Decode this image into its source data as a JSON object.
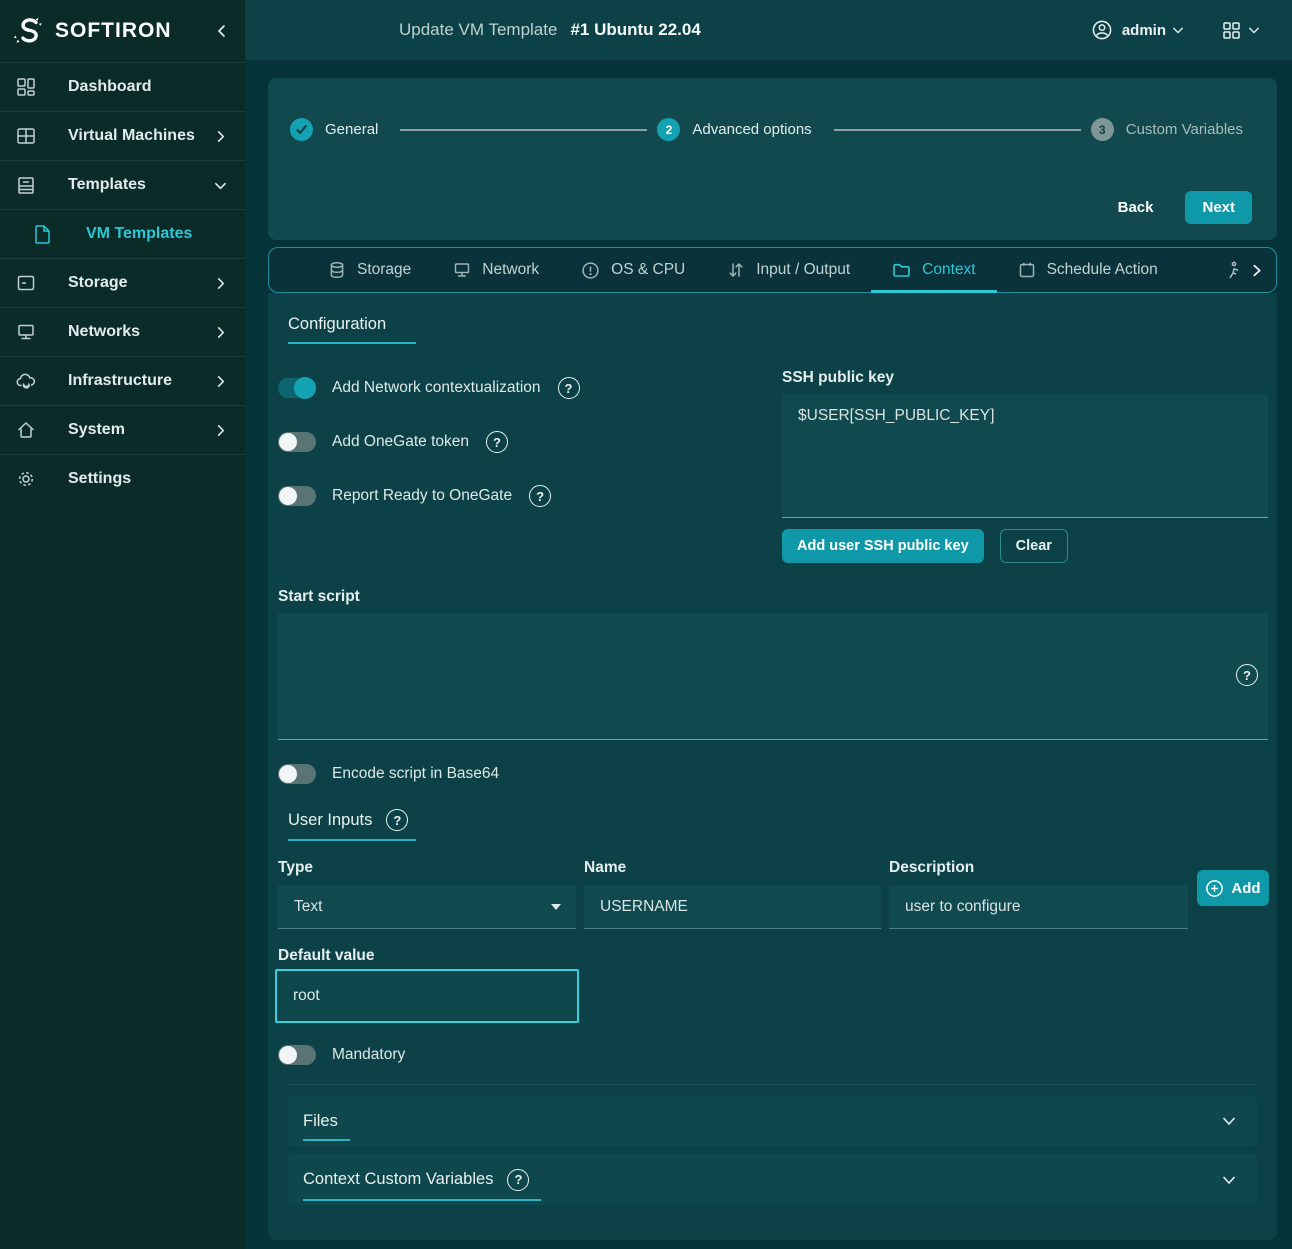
{
  "brand": {
    "name": "SOFTIRON"
  },
  "sidebar": {
    "items": [
      {
        "label": "Dashboard"
      },
      {
        "label": "Virtual Machines"
      },
      {
        "label": "Templates"
      },
      {
        "label": "VM Templates"
      },
      {
        "label": "Storage"
      },
      {
        "label": "Networks"
      },
      {
        "label": "Infrastructure"
      },
      {
        "label": "System"
      },
      {
        "label": "Settings"
      }
    ]
  },
  "header": {
    "title": "Update VM Template",
    "subtitle": "#1 Ubuntu 22.04",
    "user": {
      "name": "admin"
    }
  },
  "stepper": {
    "steps": [
      {
        "label": "General",
        "num": "",
        "state": "done"
      },
      {
        "label": "Advanced options",
        "num": "2",
        "state": "active"
      },
      {
        "label": "Custom Variables",
        "num": "3",
        "state": "pending"
      }
    ],
    "back": "Back",
    "next": "Next"
  },
  "tabs": {
    "items": [
      {
        "label": "Storage"
      },
      {
        "label": "Network"
      },
      {
        "label": "OS & CPU"
      },
      {
        "label": "Input / Output"
      },
      {
        "label": "Context"
      },
      {
        "label": "Schedule Action"
      }
    ]
  },
  "context": {
    "section_title": "Configuration",
    "toggles": [
      {
        "label": "Add Network contextualization",
        "on": true
      },
      {
        "label": "Add OneGate token",
        "on": false
      },
      {
        "label": "Report Ready to OneGate",
        "on": false
      }
    ],
    "ssh": {
      "label": "SSH public key",
      "value": "$USER[SSH_PUBLIC_KEY]",
      "add_button": "Add user SSH public key",
      "clear_button": "Clear"
    },
    "start_script": {
      "label": "Start script",
      "value": ""
    },
    "encode_toggle": {
      "label": "Encode script in Base64",
      "on": false
    },
    "user_inputs": {
      "title": "User Inputs",
      "type_label": "Type",
      "type_value": "Text",
      "name_label": "Name",
      "name_value": "USERNAME",
      "description_label": "Description",
      "description_value": "user to configure",
      "add_button": "Add",
      "default_label": "Default value",
      "default_value": "root",
      "mandatory_label": "Mandatory"
    },
    "accordions": [
      {
        "title": "Files"
      },
      {
        "title": "Context Custom Variables"
      }
    ]
  },
  "icons": {
    "help": "?"
  },
  "colors": {
    "accent": "#2bc8d6",
    "primary": "#0e98a8",
    "sidebar": "#0a2b28",
    "panel": "#0c4247"
  }
}
